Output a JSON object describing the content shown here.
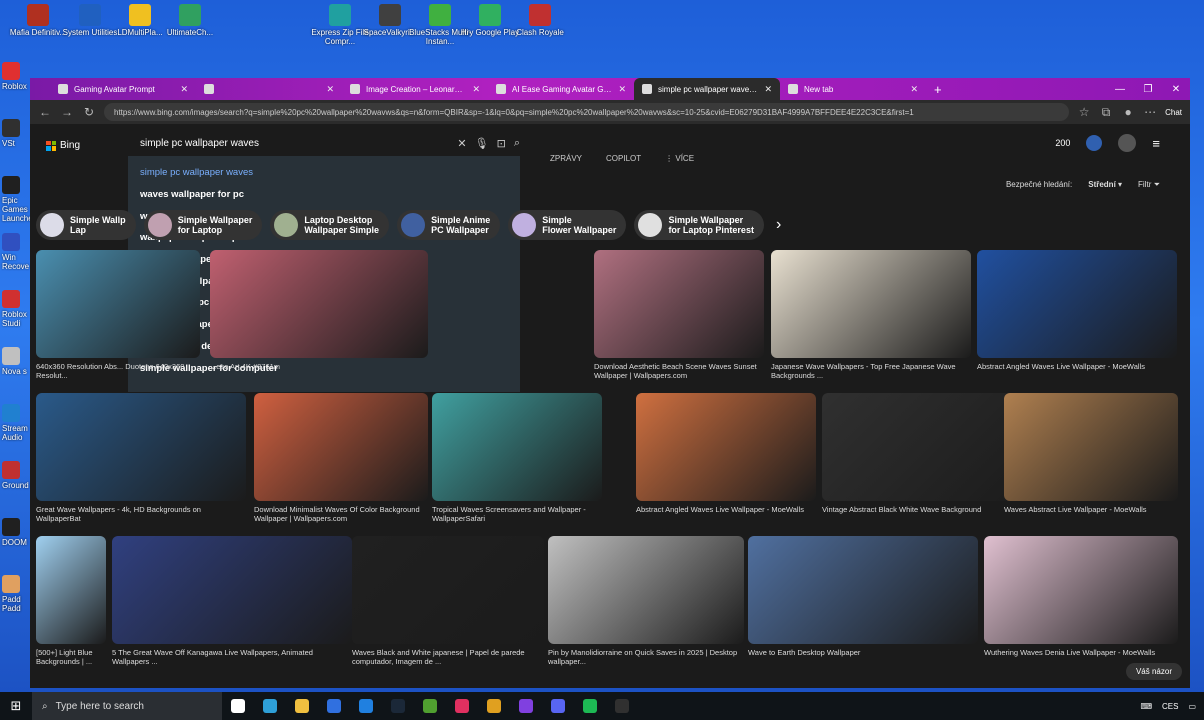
{
  "desktop": {
    "top_icons": [
      {
        "label": "Mafia Definitiv...",
        "color": "#b03020"
      },
      {
        "label": "System Utilities",
        "color": "#2060c0"
      },
      {
        "label": "LDMultiPla...",
        "color": "#f0c020"
      },
      {
        "label": "UltimateCh...",
        "color": "#30a060"
      },
      {
        "label": "Express Zip File Compr...",
        "color": "#20a0a0"
      },
      {
        "label": "SpaceValkyri...",
        "color": "#404040"
      },
      {
        "label": "BlueStacks Multi-Instan...",
        "color": "#40b040"
      },
      {
        "label": "Hry Google Play",
        "color": "#30b060"
      },
      {
        "label": "Clash Royale",
        "color": "#c03030"
      }
    ],
    "left_icons": [
      {
        "label": "Roblox",
        "color": "#e03030"
      },
      {
        "label": "VSt",
        "color": "#303030"
      },
      {
        "label": "Epic Games Launcher",
        "color": "#202020"
      },
      {
        "label": "Win Recove",
        "color": "#3050c0"
      },
      {
        "label": "Roblox Studi",
        "color": "#d03030"
      },
      {
        "label": "Nova s",
        "color": "#c0c0c0"
      },
      {
        "label": "Stream Audio",
        "color": "#2080d0"
      },
      {
        "label": "Ground",
        "color": "#c03030"
      },
      {
        "label": "DOOM",
        "color": "#202020"
      },
      {
        "label": "Padd Padd",
        "color": "#e0a060"
      }
    ]
  },
  "browser": {
    "tabs": [
      {
        "title": "Gaming Avatar Prompt",
        "active": false
      },
      {
        "title": "",
        "active": false
      },
      {
        "title": "Image Creation – Leonardo.Ai App",
        "active": false
      },
      {
        "title": "AI Ease Gaming Avatar Generator",
        "active": false
      },
      {
        "title": "simple pc wallpaper waves - Hleda",
        "active": true
      },
      {
        "title": "New tab",
        "active": false
      }
    ],
    "url": "https://www.bing.com/images/search?q=simple%20pc%20wallpaper%20wavws&qs=n&form=QBIR&sp=-1&lq=0&pq=simple%20pc%20wallpaper%20wavws&sc=10-25&cvid=E06279D31BAF4999A7BFFDEE4E22C3CE&first=1",
    "chat_label": "Chat"
  },
  "bing": {
    "logo": "Bing",
    "query": "simple pc wallpaper waves",
    "suggestions": [
      "simple pc wallpaper waves",
      "waves wallpaper for pc",
      "wave wallpaper for laptop",
      "wallpaper for pc simple",
      "waves wallpaper for walls",
      "wave live wallpaper for pc",
      "white waves pc wallpaper",
      "simple wallpaper for pc download",
      "beach waves desktop wallpaper",
      "simple wallpaper for computer"
    ],
    "rewards_points": "200",
    "subnav": [
      "ZPRÁVY",
      "COPILOT",
      "⋮ VÍCE"
    ],
    "safe_search_label": "Bezpečné hledání:",
    "safe_search_value": "Střední",
    "filter_label": "Filtr",
    "chips": [
      {
        "line1": "Simple Wallp",
        "line2": "Lap",
        "color": "#dcdce8"
      },
      {
        "line1": "Simple Wallpaper",
        "line2": "for Laptop",
        "color": "#c0a0b0"
      },
      {
        "line1": "Laptop Desktop",
        "line2": "Wallpaper Simple",
        "color": "#a0b090"
      },
      {
        "line1": "Simple Anime",
        "line2": "PC Wallpaper",
        "color": "#4060a0"
      },
      {
        "line1": "Simple",
        "line2": "Flower Wallpaper",
        "color": "#c0b0e0"
      },
      {
        "line1": "Simple Wallpaper",
        "line2": "for Laptop Pinterest",
        "color": "#e0e0e0"
      }
    ],
    "results": [
      {
        "caption": "640x360 Resolution Abs... Duotone 640x360 Resolut...",
        "color": "#4a8fb0"
      },
      {
        "caption": "...ese Art 4K #8761m",
        "color": "#c06070"
      },
      {
        "caption": "Download Aesthetic Beach Scene Waves Sunset Wallpaper | Wallpapers.com",
        "color": "#b07080"
      },
      {
        "caption": "Japanese Wave Wallpapers - Top Free Japanese Wave Backgrounds ...",
        "color": "#e8e0d0"
      },
      {
        "caption": "Abstract Angled Waves Live Wallpaper - MoeWalls",
        "color": "#2050a0"
      },
      {
        "caption": "Great Wave Wallpapers - 4k, HD Backgrounds on WallpaperBat",
        "color": "#2a5a8a"
      },
      {
        "caption": "Download Minimalist Waves Of Color Background Wallpaper | Wallpapers.com",
        "color": "#d06040"
      },
      {
        "caption": "Tropical Waves Screensavers and Wallpaper - WallpaperSafari",
        "color": "#40a0a0"
      },
      {
        "caption": "Abstract Angled Waves Live Wallpaper - MoeWalls",
        "color": "#d07040"
      },
      {
        "caption": "Vintage Abstract Black White Wave Background",
        "color": "#303030"
      },
      {
        "caption": "Waves Abstract Live Wallpaper - MoeWalls",
        "color": "#b08050"
      },
      {
        "caption": "[500+] Light Blue Backgrounds | ...",
        "color": "#a0d0f0"
      },
      {
        "caption": "5 The Great Wave Off Kanagawa Live Wallpapers, Animated Wallpapers ...",
        "color": "#304080"
      },
      {
        "caption": "Waves Black and White japanese | Papel de parede computador, Imagem de ...",
        "color": "#202020"
      },
      {
        "caption": "Pin by Manolidiorraine on Quick Saves in 2025 | Desktop wallpaper...",
        "color": "#c0c0c0"
      },
      {
        "caption": "Wave to Earth Desktop Wallpaper",
        "color": "#5070a0"
      },
      {
        "caption": "Wuthering Waves Denia Live Wallpaper - MoeWalls",
        "color": "#e0c0d0"
      }
    ],
    "feedback": "Váš názor"
  },
  "taskbar": {
    "search_placeholder": "Type here to search",
    "apps": [
      {
        "name": "task-view-icon",
        "color": "#ffffff"
      },
      {
        "name": "edge-icon",
        "color": "#2ea0d8"
      },
      {
        "name": "file-explorer-icon",
        "color": "#f0c040"
      },
      {
        "name": "store-icon",
        "color": "#3070e0"
      },
      {
        "name": "mail-icon",
        "color": "#2080e0"
      },
      {
        "name": "steam-icon",
        "color": "#1b2838"
      },
      {
        "name": "minecraft-icon",
        "color": "#50a030"
      },
      {
        "name": "app-icon",
        "color": "#e03060"
      },
      {
        "name": "chrome-icon",
        "color": "#e0a020"
      },
      {
        "name": "messenger-icon",
        "color": "#8040e0"
      },
      {
        "name": "discord-icon",
        "color": "#5865f2"
      },
      {
        "name": "spotify-icon",
        "color": "#1db954"
      },
      {
        "name": "obs-icon",
        "color": "#303030"
      }
    ],
    "lang": "CES"
  }
}
